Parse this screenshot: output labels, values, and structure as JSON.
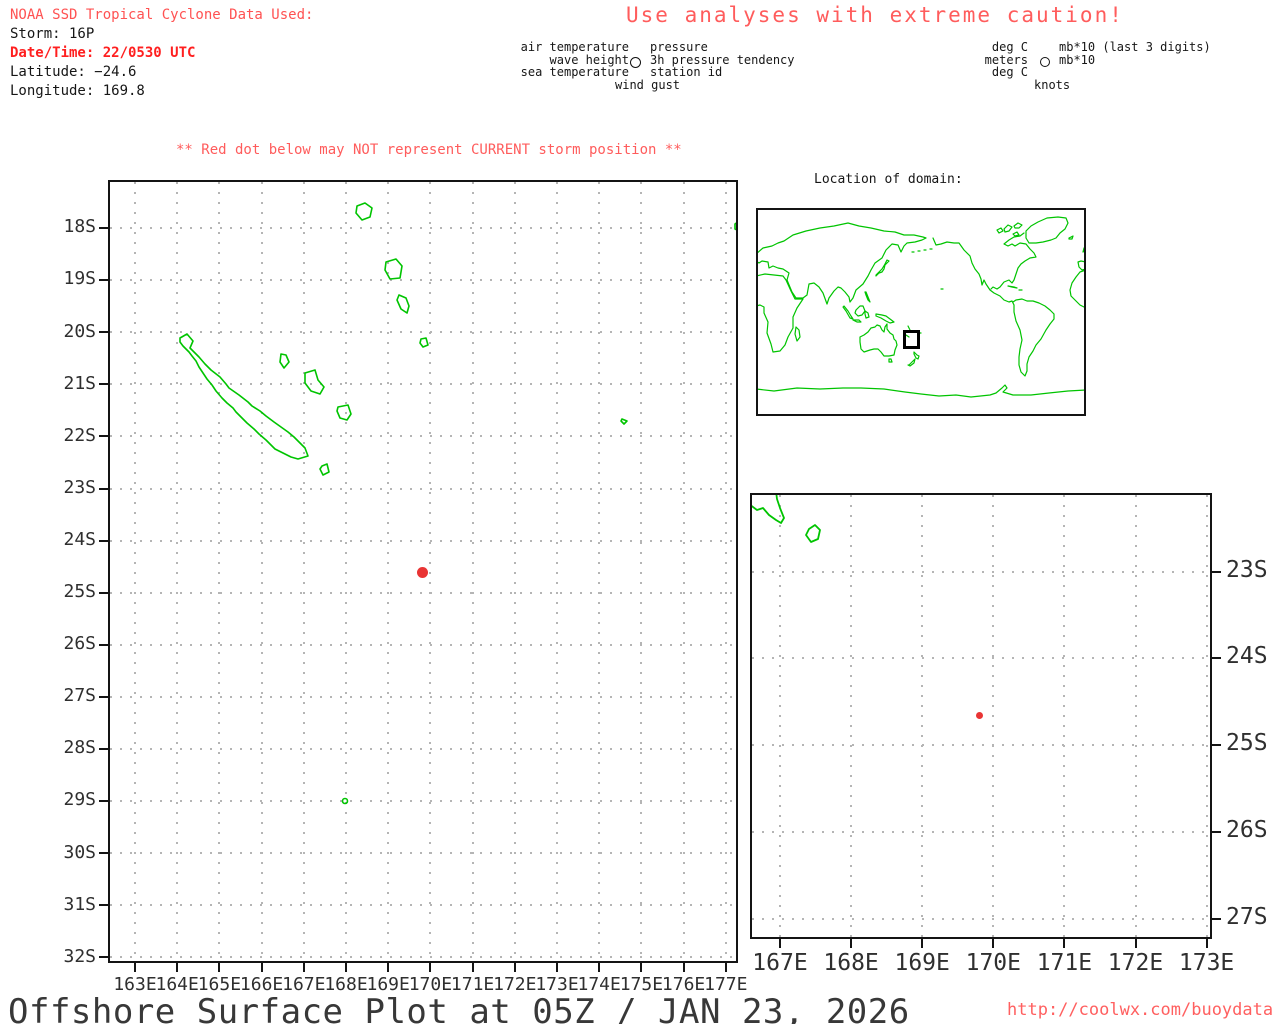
{
  "header": {
    "source_line": "NOAA SSD Tropical Cyclone Data Used:",
    "storm_line": "Storm: 16P",
    "datetime_line": "Date/Time: 22/0530 UTC",
    "latitude_line": "Latitude: −24.6",
    "longitude_line": "Longitude: 169.8",
    "caution_line": "Use analyses with extreme caution!"
  },
  "station_model_legend": {
    "left": [
      "air temperature",
      "wave height",
      "sea temperature"
    ],
    "right": [
      "pressure",
      "3h pressure tendency",
      "station id"
    ],
    "bottom": "wind gust"
  },
  "units_legend": {
    "left": [
      "deg C",
      "meters",
      "deg C"
    ],
    "right": [
      "mb*10 (last 3 digits)",
      "mb*10"
    ],
    "bottom": "knots"
  },
  "storm_warning": "** Red dot below may NOT represent CURRENT storm position **",
  "main_map": {
    "lat_labels": [
      "18S",
      "19S",
      "20S",
      "21S",
      "22S",
      "23S",
      "24S",
      "25S",
      "26S",
      "27S",
      "28S",
      "29S",
      "30S",
      "31S",
      "32S"
    ],
    "lon_labels": [
      "163E",
      "164E",
      "165E",
      "166E",
      "167E",
      "168E",
      "169E",
      "170E",
      "171E",
      "172E",
      "173E",
      "174E",
      "175E",
      "176E",
      "177E"
    ],
    "storm_dot": {
      "lon_e": 169.8,
      "lat_s": 24.6
    }
  },
  "inset_map": {
    "title": "Location of domain:"
  },
  "zoom_map": {
    "lat_labels": [
      "23S",
      "24S",
      "25S",
      "26S",
      "27S"
    ],
    "lon_labels": [
      "167E",
      "168E",
      "169E",
      "170E",
      "171E",
      "172E",
      "173E"
    ],
    "storm_dot": {
      "lon_e": 169.8,
      "lat_s": 24.6
    }
  },
  "footer": {
    "title": "Offshore Surface Plot at 05Z / JAN 23, 2026",
    "url": "http://coolwx.com/buoydata"
  },
  "colors": {
    "header_red": "#ff5252",
    "datetime_red": "#ff1f1f",
    "caution_red": "#ff5c5c",
    "coast_green": "#00c400",
    "storm_dot_red": "#e93434",
    "grid_gray": "#b5b5b5",
    "url_red": "#ff6060"
  }
}
